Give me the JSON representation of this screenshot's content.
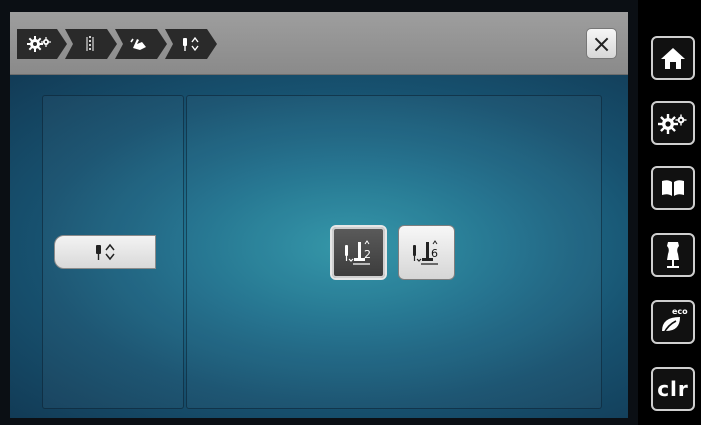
{
  "breadcrumbs": [
    {
      "icon": "gear-icon"
    },
    {
      "icon": "stitch-icon"
    },
    {
      "icon": "hand-icon"
    },
    {
      "icon": "needle-updown-icon"
    }
  ],
  "close_label": "×",
  "left_panel": {
    "mode_icon": "needle-updown-icon"
  },
  "options": [
    {
      "number": "2",
      "state": "selected",
      "icon": "needle-presser-foot-icon"
    },
    {
      "number": "6",
      "state": "unselected",
      "icon": "needle-presser-foot-icon"
    }
  ],
  "sidebar": {
    "items": [
      {
        "icon": "home-icon"
      },
      {
        "icon": "settings-icon"
      },
      {
        "icon": "book-icon"
      },
      {
        "icon": "dress-form-icon"
      },
      {
        "icon": "eco-leaf-icon",
        "label": "eco"
      },
      {
        "label": "clr"
      }
    ]
  },
  "colors": {
    "topbar": "#9a9a9a",
    "content_center": "#2f95a7",
    "content_edge": "#123b56",
    "selected_button": "#4a4a4a"
  }
}
